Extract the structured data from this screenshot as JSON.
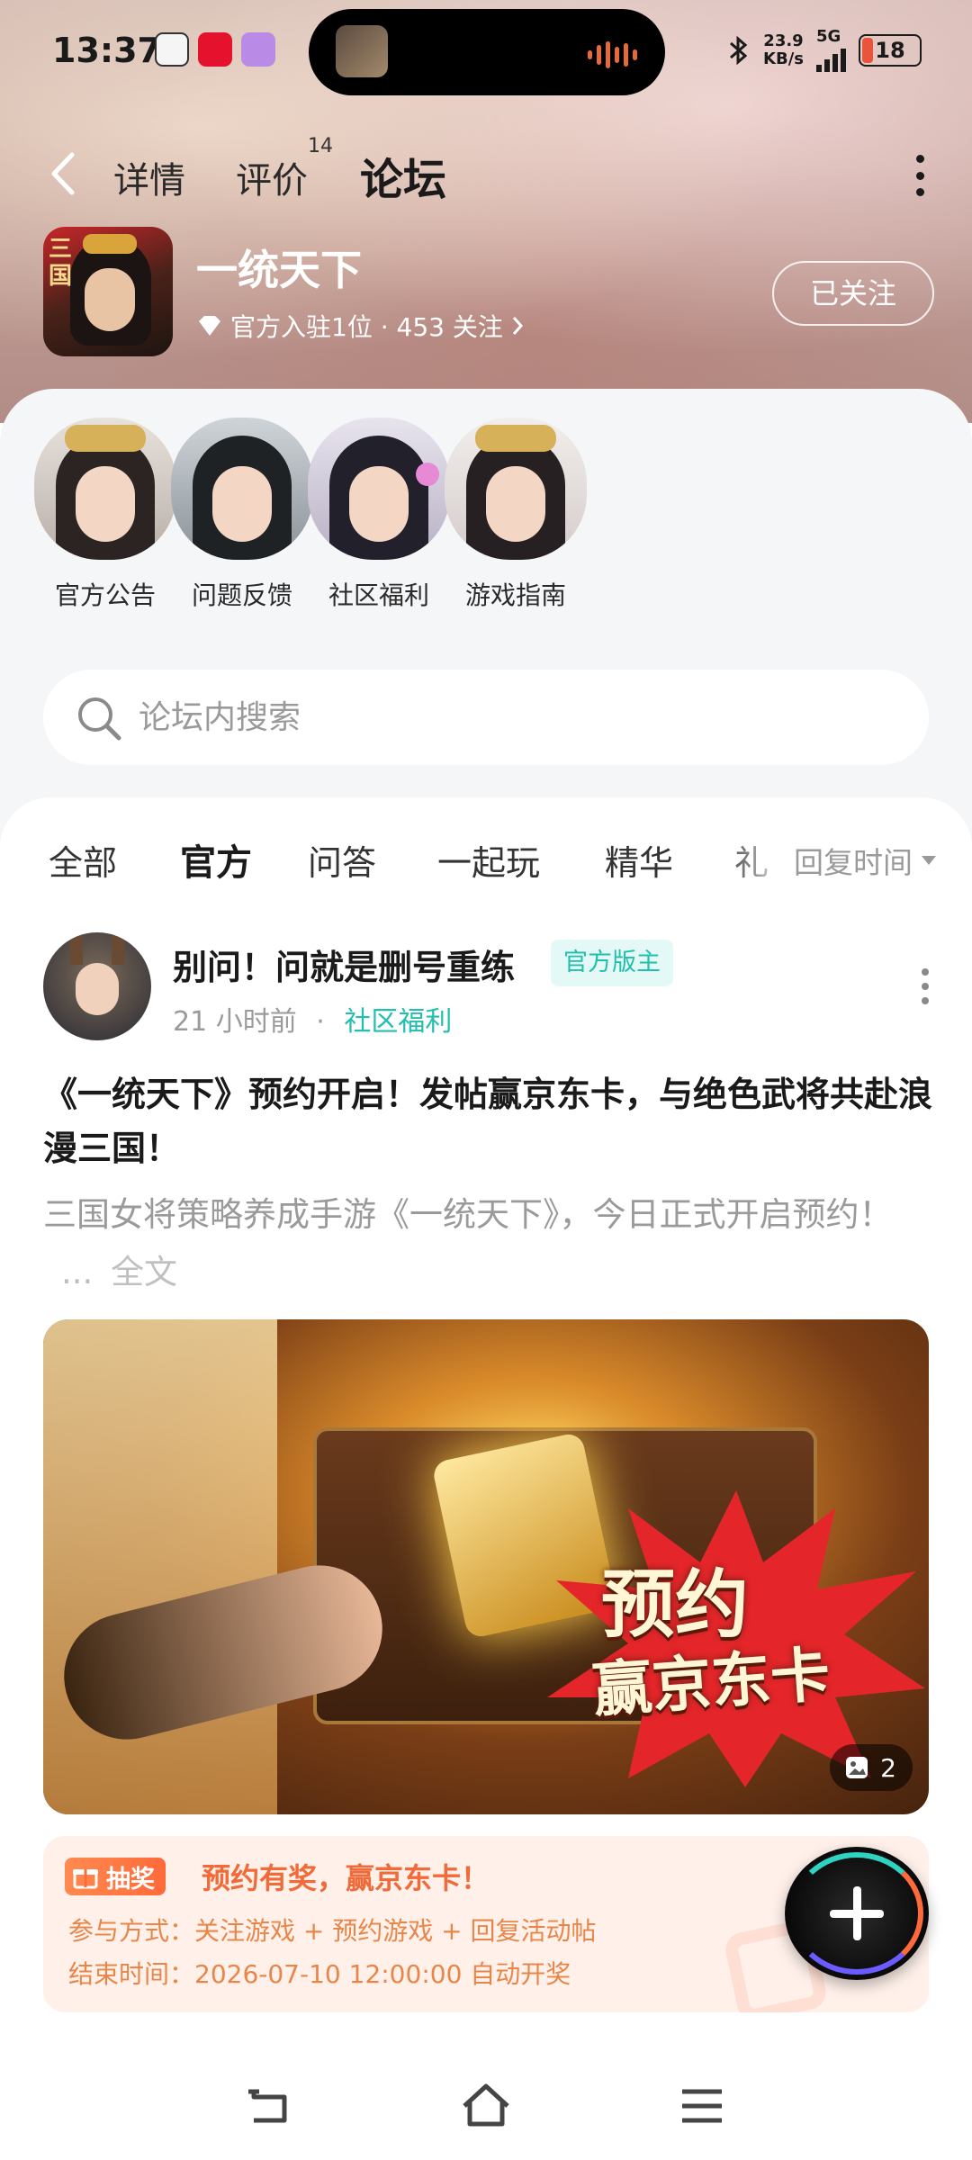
{
  "status_bar": {
    "time": "13:37",
    "net_speed_value": "23.9",
    "net_speed_unit": "KB/s",
    "network": "5G",
    "battery": "18"
  },
  "nav": {
    "tabs": [
      {
        "label": "详情"
      },
      {
        "label": "评价",
        "count": "14"
      },
      {
        "label": "论坛"
      }
    ]
  },
  "game": {
    "name": "一统天下",
    "logo_text": "三国",
    "meta": "官方入驻1位 · 453 关注",
    "follow_label": "已关注"
  },
  "quick_links": [
    {
      "label": "官方公告"
    },
    {
      "label": "问题反馈"
    },
    {
      "label": "社区福利"
    },
    {
      "label": "游戏指南"
    }
  ],
  "search": {
    "placeholder": "论坛内搜索"
  },
  "filters": {
    "tabs": [
      "全部",
      "官方",
      "问答",
      "一起玩",
      "精华",
      "礼"
    ],
    "active": "官方",
    "sort_label": "回复时间"
  },
  "post": {
    "author": "别问！问就是删号重练",
    "role_badge": "官方版主",
    "time": "21 小时前",
    "category": "社区福利",
    "title": "《一统天下》预约开启！发帖赢京东卡，与绝色武将共赴浪漫三国！",
    "summary": "三国女将策略养成手游《一统天下》，今日正式开启预约！",
    "ellipsis": "...",
    "full_text_label": "全文",
    "image_text_1": "预约",
    "image_text_2": "赢京东卡",
    "image_count": "2"
  },
  "lottery": {
    "tag": "抽奖",
    "title": "预约有奖，赢京东卡！",
    "method": "参与方式：关注游戏 + 预约游戏 + 回复活动帖",
    "end_time": "结束时间：2026-07-10 12:00:00 自动开奖"
  },
  "colors": {
    "accent": "#2fd3c2",
    "orange": "#f06a3a"
  }
}
